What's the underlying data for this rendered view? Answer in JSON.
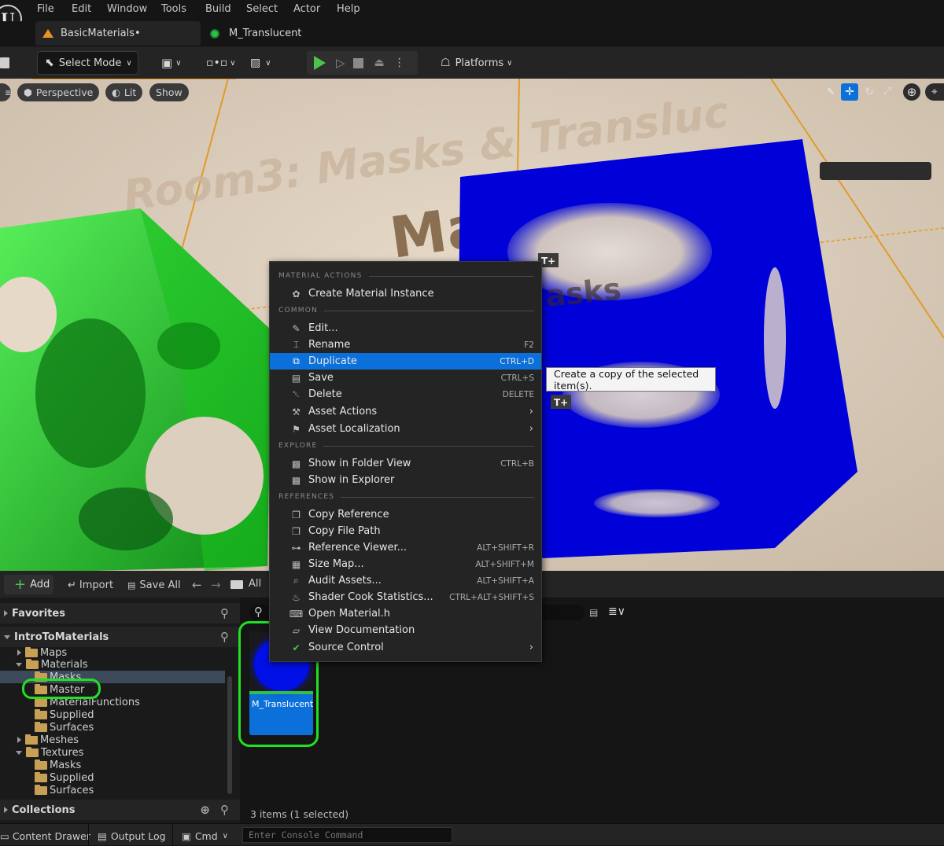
{
  "menu": {
    "logo": "U",
    "items": [
      "File",
      "Edit",
      "Window",
      "Tools",
      "Build",
      "Select",
      "Actor",
      "Help"
    ]
  },
  "tabs": [
    {
      "label": "BasicMaterials•",
      "icon": "level-icon"
    },
    {
      "label": "M_Translucent",
      "icon": "material-icon"
    }
  ],
  "toolbar": {
    "select_mode": "Select Mode",
    "platforms": "Platforms"
  },
  "viewport": {
    "perspective": "Perspective",
    "lit": "Lit",
    "show": "Show",
    "room_text_1": "Room3: Masks & Transluc",
    "room_text_2": "Materials",
    "room_text_3": "asks",
    "text_actor_icon": "T+"
  },
  "context_menu": {
    "sections": [
      {
        "title": "MATERIAL ACTIONS"
      },
      {
        "title": "COMMON"
      },
      {
        "title": "EXPLORE"
      },
      {
        "title": "REFERENCES"
      }
    ],
    "items": [
      {
        "label": "Create Material Instance",
        "shortcut": "",
        "icon": "create-instance-icon"
      },
      {
        "label": "Edit...",
        "shortcut": "",
        "icon": "edit-icon"
      },
      {
        "label": "Rename",
        "shortcut": "F2",
        "icon": "rename-icon"
      },
      {
        "label": "Duplicate",
        "shortcut": "CTRL+D",
        "icon": "duplicate-icon",
        "selected": true
      },
      {
        "label": "Save",
        "shortcut": "CTRL+S",
        "icon": "save-icon"
      },
      {
        "label": "Delete",
        "shortcut": "DELETE",
        "icon": "delete-icon"
      },
      {
        "label": "Asset Actions",
        "shortcut": "",
        "icon": "wrench-icon",
        "submenu": true
      },
      {
        "label": "Asset Localization",
        "shortcut": "",
        "icon": "flag-icon",
        "submenu": true
      },
      {
        "label": "Show in Folder View",
        "shortcut": "CTRL+B",
        "icon": "folder-search-icon"
      },
      {
        "label": "Show in Explorer",
        "shortcut": "",
        "icon": "folder-search-icon"
      },
      {
        "label": "Copy Reference",
        "shortcut": "",
        "icon": "copy-icon"
      },
      {
        "label": "Copy File Path",
        "shortcut": "",
        "icon": "copy-icon"
      },
      {
        "label": "Reference Viewer...",
        "shortcut": "ALT+SHIFT+R",
        "icon": "reference-viewer-icon"
      },
      {
        "label": "Size Map...",
        "shortcut": "ALT+SHIFT+M",
        "icon": "size-map-icon"
      },
      {
        "label": "Audit Assets...",
        "shortcut": "ALT+SHIFT+A",
        "icon": "audit-icon"
      },
      {
        "label": "Shader Cook Statistics...",
        "shortcut": "CTRL+ALT+SHIFT+S",
        "icon": "shader-icon"
      },
      {
        "label": "Open Material.h",
        "shortcut": "",
        "icon": "code-icon"
      },
      {
        "label": "View Documentation",
        "shortcut": "",
        "icon": "docs-icon"
      },
      {
        "label": "Source Control",
        "shortcut": "",
        "icon": "source-control-icon",
        "submenu": true
      }
    ]
  },
  "tooltip": "Create a copy of the selected item(s).",
  "content_browser": {
    "add": "Add",
    "import": "Import",
    "save_all": "Save All",
    "path_all": "All",
    "favorites": "Favorites",
    "project": "IntroToMaterials",
    "tree": [
      "Maps",
      "Materials",
      "Masks",
      "Master",
      "MaterialFunctions",
      "Supplied",
      "Surfaces",
      "Meshes",
      "Textures",
      "Masks",
      "Supplied",
      "Surfaces"
    ],
    "collections": "Collections",
    "asset_name": "M_Translucent",
    "item_count": "3 items (1 selected)"
  },
  "statusbar": {
    "content_drawer": "Content Drawer",
    "output_log": "Output Log",
    "cmd": "Cmd",
    "console_placeholder": "Enter Console Command"
  },
  "colors": {
    "accent": "#0b70d9",
    "highlight": "#22e022",
    "play": "#4cc44c"
  }
}
